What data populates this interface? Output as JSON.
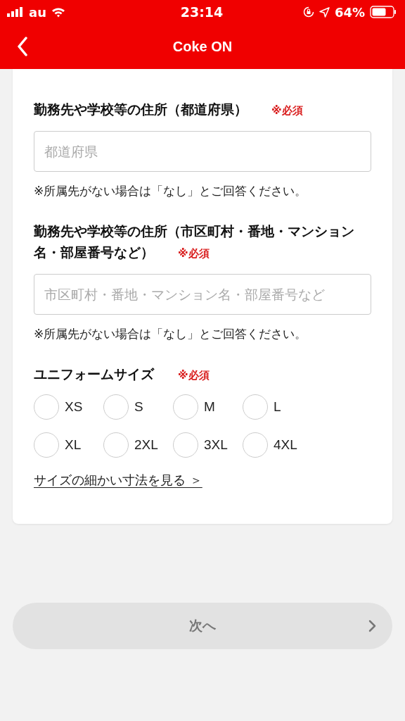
{
  "status_bar": {
    "carrier": "au",
    "time": "23:14",
    "battery": "64%"
  },
  "nav": {
    "title": "Coke ON"
  },
  "fields": [
    {
      "label": "勤務先や学校等の住所（都道府県）",
      "required": "※必須",
      "placeholder": "都道府県",
      "note": "※所属先がない場合は「なし」とご回答ください。"
    },
    {
      "label": "勤務先や学校等の住所（市区町村・番地・マンション名・部屋番号など）",
      "required": "※必須",
      "placeholder": "市区町村・番地・マンション名・部屋番号など",
      "note": "※所属先がない場合は「なし」とご回答ください。"
    }
  ],
  "uniform": {
    "label": "ユニフォームサイズ",
    "required": "※必須",
    "sizes": [
      {
        "label": "XS",
        "selected": false
      },
      {
        "label": "S",
        "selected": false
      },
      {
        "label": "M",
        "selected": false
      },
      {
        "label": "L",
        "selected": false
      },
      {
        "label": "XL",
        "selected": false
      },
      {
        "label": "2XL",
        "selected": false
      },
      {
        "label": "3XL",
        "selected": false
      },
      {
        "label": "4XL",
        "selected": false
      }
    ],
    "link": "サイズの細かい寸法を見る ＞"
  },
  "next_button": {
    "label": "次へ",
    "disabled": true
  }
}
